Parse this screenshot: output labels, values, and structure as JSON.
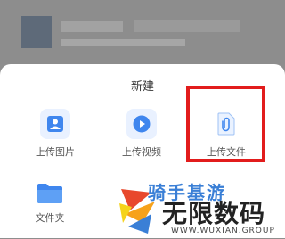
{
  "sheet": {
    "title": "新建",
    "items": [
      {
        "label": "上传图片",
        "icon": "image-upload-icon"
      },
      {
        "label": "上传视频",
        "icon": "video-upload-icon"
      },
      {
        "label": "上传文件",
        "icon": "file-upload-icon"
      },
      {
        "label": "文件夹",
        "icon": "folder-icon"
      }
    ]
  },
  "watermark": {
    "top_text": "骑手基游",
    "main_text": "无限数码",
    "sub_text": "WWW.WUXIAN.GROUP"
  },
  "colors": {
    "accent": "#3f86ee",
    "highlight": "#e21c1c",
    "backdrop": "#8e8e8e"
  }
}
